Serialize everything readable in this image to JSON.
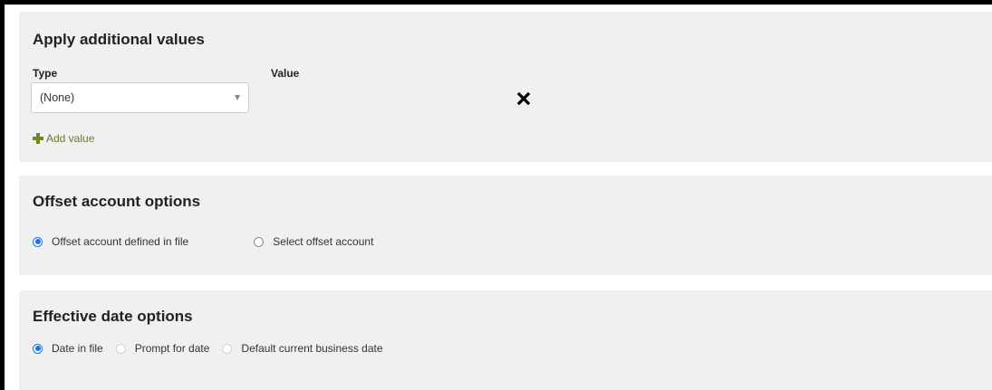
{
  "additional_values": {
    "title": "Apply additional values",
    "type_label": "Type",
    "value_label": "Value",
    "type_select_value": "(None)",
    "remove_icon": "close-icon",
    "add_value_label": "Add value",
    "add_icon": "plus-icon",
    "add_color": "#6b7a32"
  },
  "offset_account": {
    "title": "Offset account options",
    "options": [
      {
        "label": "Offset account defined in file",
        "checked": true
      },
      {
        "label": "Select offset account",
        "checked": false
      }
    ]
  },
  "effective_date": {
    "title": "Effective date options",
    "options": [
      {
        "label": "Date in file",
        "checked": true
      },
      {
        "label": "Prompt for date",
        "checked": false
      },
      {
        "label": "Default current business date",
        "checked": false
      }
    ]
  },
  "colors": {
    "panel_bg": "#f0f0f0",
    "radio_selected": "#1a73e8"
  }
}
